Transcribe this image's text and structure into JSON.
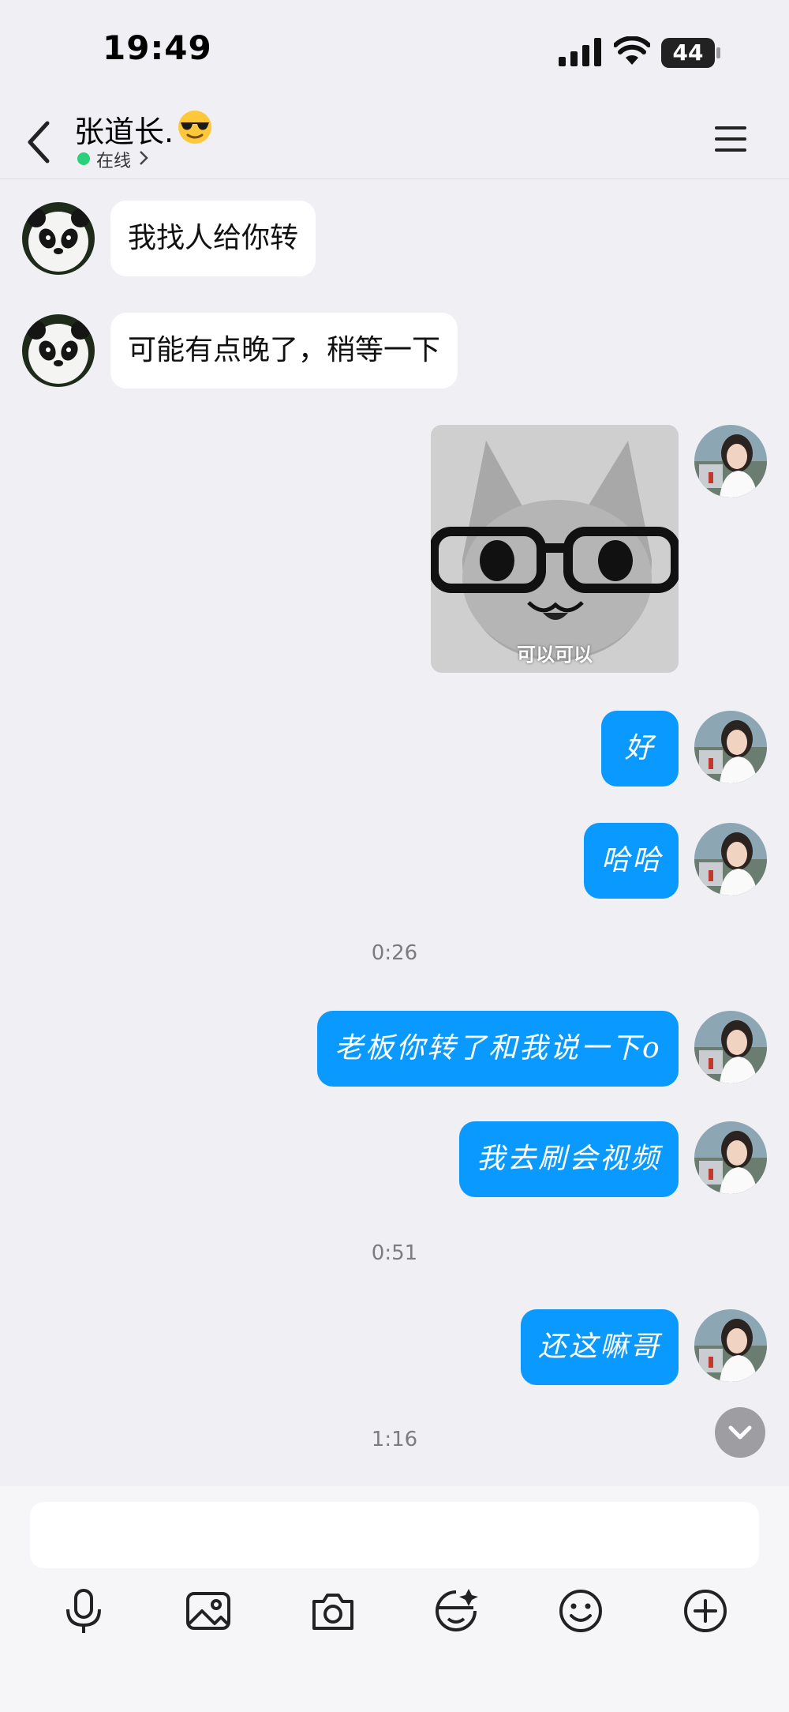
{
  "status_bar": {
    "time": "19:49",
    "battery": "44"
  },
  "header": {
    "name": "张道长.",
    "status": "在线"
  },
  "messages": [
    {
      "side": "in",
      "text": "我找人给你转"
    },
    {
      "side": "in",
      "text": "可能有点晚了，稍等一下"
    },
    {
      "side": "out",
      "sticker_caption": "可以可以"
    },
    {
      "side": "out",
      "text": "好"
    },
    {
      "side": "out",
      "text": "哈哈"
    },
    {
      "timestamp": "0:26"
    },
    {
      "side": "out",
      "text": "老板你转了和我说一下o"
    },
    {
      "side": "out",
      "text": "我去刷会视频"
    },
    {
      "timestamp": "0:51"
    },
    {
      "side": "out",
      "text": "还这嘛哥"
    },
    {
      "timestamp": "1:16"
    }
  ],
  "input": {
    "placeholder": "",
    "value": ""
  },
  "toolbar": [
    "microphone-icon",
    "image-icon",
    "camera-icon",
    "sticker-icon",
    "emoji-icon",
    "plus-icon"
  ],
  "colors": {
    "outgoing_bubble": "#0a9aff",
    "incoming_bubble": "#ffffff",
    "online_dot": "#2bd07a",
    "background": "#f0f0f4"
  }
}
